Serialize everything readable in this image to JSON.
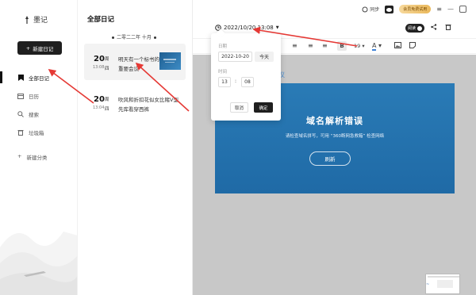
{
  "app": {
    "name": "墨记"
  },
  "sidebar": {
    "new_button": "新建日记",
    "items": [
      {
        "label": "全部日记",
        "icon": "bookmark-icon",
        "active": true
      },
      {
        "label": "日历",
        "icon": "calendar-icon",
        "active": false
      },
      {
        "label": "搜索",
        "icon": "search-icon",
        "active": false
      },
      {
        "label": "垃圾箱",
        "icon": "trash-icon",
        "active": false
      }
    ],
    "add_category": "新建分类"
  },
  "list": {
    "title": "全部日记",
    "month": "二零二二年 十月",
    "entries": [
      {
        "day": "20",
        "week": "周",
        "time": "13:08",
        "week2": "四",
        "title": "明天有一个标书的重要会议",
        "selected": true
      },
      {
        "day": "20",
        "week": "周",
        "time": "13:04",
        "week2": "四",
        "title": "吹风和折扣花似女比赌V型先库看穿西裤",
        "selected": false
      }
    ]
  },
  "topbar": {
    "sync": "同步",
    "vip": "会员免费试用",
    "read_mode": "阅读"
  },
  "editor": {
    "datetime": "2022/10/20 13:08",
    "font_size": "19",
    "doc_title_fragment": "要会议"
  },
  "error_page": {
    "title": "域名解析错误",
    "description": "请检查域名拼写，可用 “360断网急救箱” 检查网络",
    "refresh": "刷新"
  },
  "date_popup": {
    "date_label": "日期",
    "date_value": "2022-10-20",
    "today": "今天",
    "time_label": "时间",
    "hour": "13",
    "minute": "08",
    "cancel": "取消",
    "confirm": "确定"
  },
  "colors": {
    "accent_dark": "#1f1f1f",
    "error_blue": "#2a7bb6",
    "link_blue": "#4a8fd4",
    "arrow_red": "#e53935"
  }
}
